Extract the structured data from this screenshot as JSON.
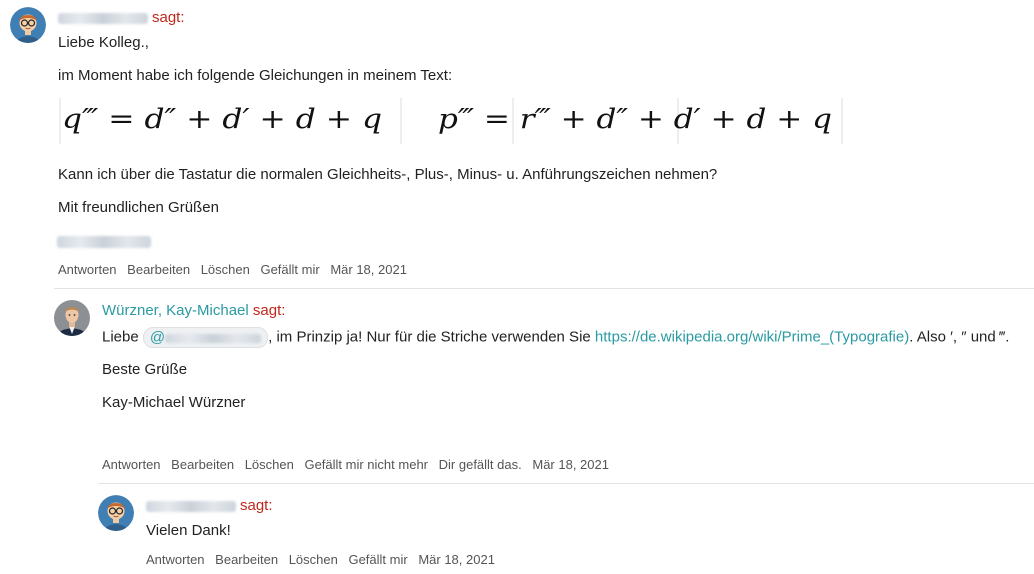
{
  "comment1": {
    "says": "sagt:",
    "greeting": "Liebe Kolleg.,",
    "intro": "im Moment habe ich folgende Gleichungen in meinem Text:",
    "formula_left": "q‴ = d″ + d′ + d + q",
    "formula_right": "p‴ = r‴ + d″ + d′ + d + q",
    "question": "Kann ich über die Tastatur die normalen Gleichheits-, Plus-, Minus- u. Anführungszeichen nehmen?",
    "closing": "Mit freundlichen Grüßen",
    "actions": {
      "reply": "Antworten",
      "edit": "Bearbeiten",
      "delete": "Löschen",
      "like": "Gefällt mir",
      "date": "Mär 18, 2021"
    }
  },
  "comment2": {
    "author": "Würzner, Kay-Michael",
    "says": "sagt:",
    "text_before": "Liebe",
    "mention_at": "@",
    "text_mid": ", im Prinzip ja! Nur für die Striche verwenden Sie",
    "link": "https://de.wikipedia.org/wiki/Prime_(Typografie)",
    "text_after": ". Also ′, ″ und ‴.",
    "regards": "Beste Grüße",
    "signature": "Kay-Michael Würzner",
    "actions": {
      "reply": "Antworten",
      "edit": "Bearbeiten",
      "delete": "Löschen",
      "unlike": "Gefällt mir nicht mehr",
      "liked": "Dir gefällt das.",
      "date": "Mär 18, 2021"
    }
  },
  "comment3": {
    "says": "sagt:",
    "text": "Vielen Dank!",
    "actions": {
      "reply": "Antworten",
      "edit": "Bearbeiten",
      "delete": "Löschen",
      "like": "Gefällt mir",
      "date": "Mär 18, 2021"
    }
  },
  "colors": {
    "accent": "#2a9aa3",
    "says": "#c0271d"
  },
  "icons": {
    "user_avatar": "cartoon-user-avatar-icon",
    "kay_avatar": "profile-photo-avatar"
  }
}
